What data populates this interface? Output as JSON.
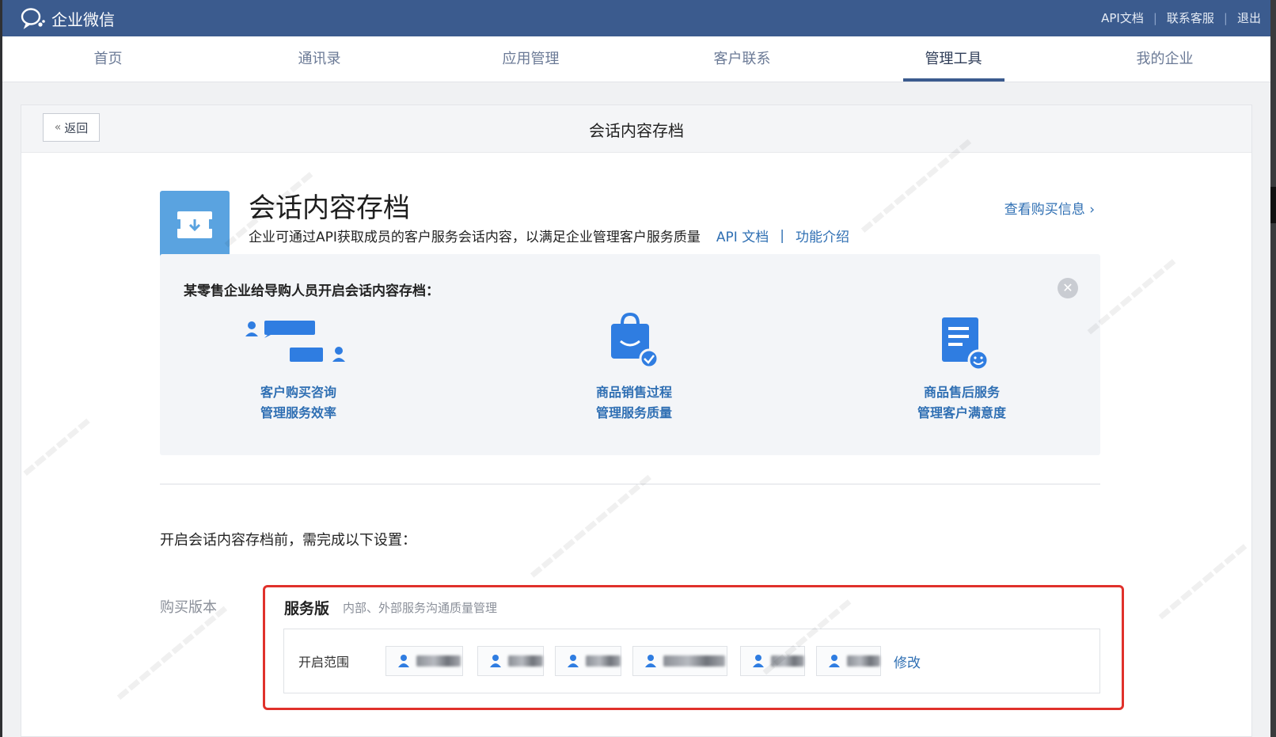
{
  "app": {
    "name": "企业微信"
  },
  "top_links": [
    "API文档",
    "联系客服",
    "退出"
  ],
  "nav": {
    "tabs": [
      {
        "label": "首页"
      },
      {
        "label": "通讯录"
      },
      {
        "label": "应用管理"
      },
      {
        "label": "客户联系"
      },
      {
        "label": "管理工具",
        "active": true
      },
      {
        "label": "我的企业"
      }
    ]
  },
  "panel": {
    "back_label": "返回",
    "title": "会话内容存档"
  },
  "hero": {
    "title": "会话内容存档",
    "description": "企业可通过API获取成员的客户服务会话内容，以满足企业管理客户服务质量",
    "api_link": "API 文档",
    "divider": "|",
    "feature_link": "功能介绍",
    "buy_info": "查看购买信息 ›"
  },
  "example": {
    "title": "某零售企业给导购人员开启会话内容存档：",
    "features": [
      {
        "line1": "客户购买咨询",
        "line2": "管理服务效率",
        "icon": "chat-icon"
      },
      {
        "line1": "商品销售过程",
        "line2": "管理服务质量",
        "icon": "shopping-bag-icon"
      },
      {
        "line1": "商品售后服务",
        "line2": "管理客户满意度",
        "icon": "document-smile-icon"
      }
    ]
  },
  "setup": {
    "title": "开启会话内容存档前，需完成以下设置：",
    "buy_label": "购买版本",
    "edition": "服务版",
    "edition_desc": "内部、外部服务沟通质量管理",
    "scope_label": "开启范围",
    "modify_label": "修改"
  },
  "colors": {
    "topbar": "#3b5b8e",
    "link": "#2f6fb3",
    "icon_blue": "#2f7de1",
    "highlight": "#e0312b"
  }
}
